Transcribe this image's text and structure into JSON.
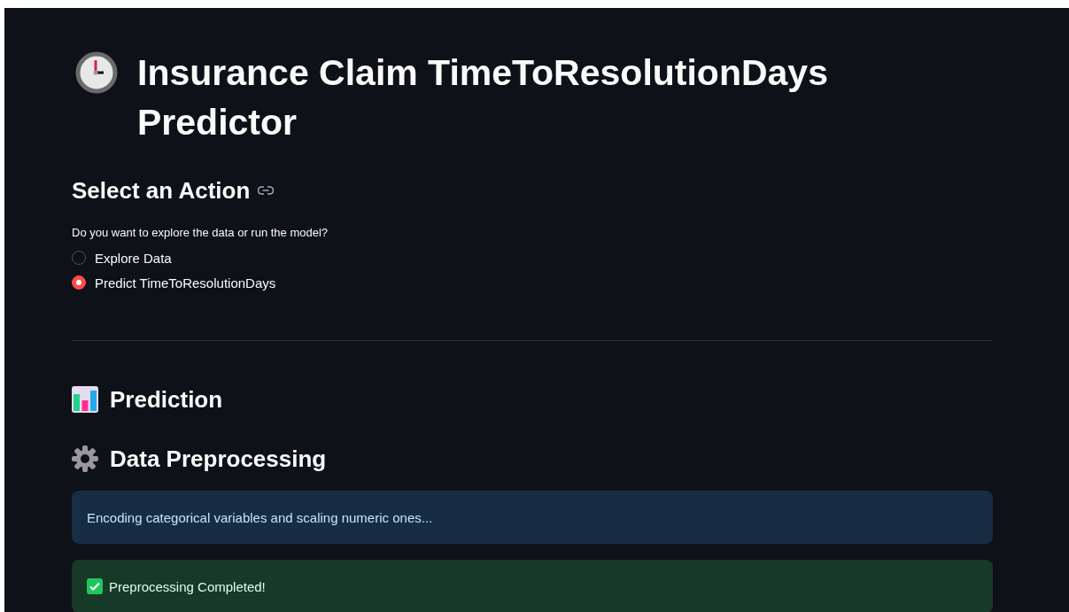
{
  "title": "Insurance Claim TimeToResolutionDays Predictor",
  "action_section": {
    "heading": "Select an Action",
    "question": "Do you want to explore the data or run the model?",
    "options": [
      {
        "label": "Explore Data",
        "selected": false
      },
      {
        "label": "Predict TimeToResolutionDays",
        "selected": true
      }
    ]
  },
  "prediction_heading": "Prediction",
  "preprocessing_heading": "Data Preprocessing",
  "messages": [
    {
      "kind": "info",
      "text": "Encoding categorical variables and scaling numeric ones..."
    },
    {
      "kind": "success",
      "text": "Preprocessing Completed!"
    }
  ]
}
